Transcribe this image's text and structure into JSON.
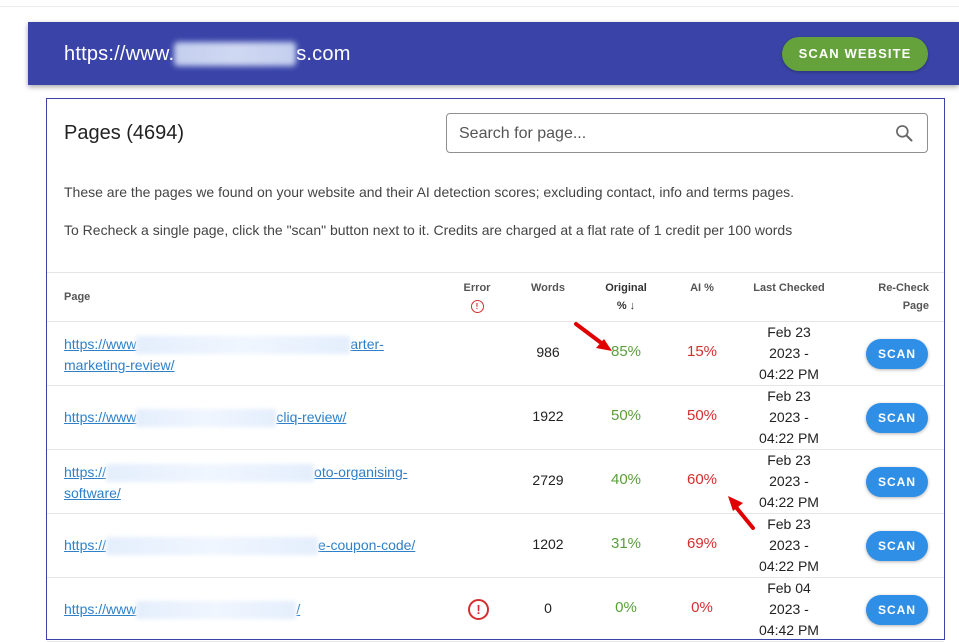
{
  "header": {
    "url_prefix": "https://www.",
    "url_suffix": "s.com",
    "scan_website_label": "SCAN WEBSITE"
  },
  "pages": {
    "title": "Pages (4694)",
    "search_placeholder": "Search for page...",
    "description_1": "These are the pages we found on your website and their AI detection scores; excluding contact, info and terms pages.",
    "description_2": "To Recheck a single page, click the \"scan\" button next to it. Credits are charged at a flat rate of 1 credit per 100 words"
  },
  "table": {
    "headers": {
      "page": "Page",
      "error": "Error",
      "words": "Words",
      "original_line1": "Original",
      "original_line2": "% ↓",
      "ai": "AI %",
      "last_checked": "Last Checked",
      "recheck_line1": "Re-Check",
      "recheck_line2": "Page"
    },
    "rows": [
      {
        "link_start": "https://www",
        "link_end": "arter-",
        "link_line2": "marketing-review/",
        "error": false,
        "words": "986",
        "original": "85%",
        "ai": "15%",
        "date_line1": "Feb 23",
        "date_line2": "2023 -",
        "date_line3": "04:22 PM",
        "scan_label": "SCAN"
      },
      {
        "link_start": "https://www",
        "link_end": "cliq-review/",
        "link_line2": "",
        "error": false,
        "words": "1922",
        "original": "50%",
        "ai": "50%",
        "date_line1": "Feb 23",
        "date_line2": "2023 -",
        "date_line3": "04:22 PM",
        "scan_label": "SCAN"
      },
      {
        "link_start": "https://",
        "link_end": "oto-organising-",
        "link_line2": "software/",
        "error": false,
        "words": "2729",
        "original": "40%",
        "ai": "60%",
        "date_line1": "Feb 23",
        "date_line2": "2023 -",
        "date_line3": "04:22 PM",
        "scan_label": "SCAN"
      },
      {
        "link_start": "https://",
        "link_end": "e-coupon-code/",
        "link_line2": "",
        "error": false,
        "words": "1202",
        "original": "31%",
        "ai": "69%",
        "date_line1": "Feb 23",
        "date_line2": "2023 -",
        "date_line3": "04:22 PM",
        "scan_label": "SCAN"
      },
      {
        "link_start": "https://www",
        "link_end": "/",
        "link_line2": "",
        "error": true,
        "error_symbol": "!",
        "words": "0",
        "original": "0%",
        "ai": "0%",
        "date_line1": "Feb 04",
        "date_line2": "2023 -",
        "date_line3": "04:42 PM",
        "scan_label": "SCAN"
      }
    ]
  },
  "colors": {
    "header_bg": "#3a44a8",
    "scan_website_bg": "#65a23b",
    "scan_button_bg": "#2f8fe6",
    "original_green": "#58a03a",
    "ai_red": "#d32f2f",
    "link_blue": "#2f80c8",
    "annotation_arrow": "#e00000"
  }
}
